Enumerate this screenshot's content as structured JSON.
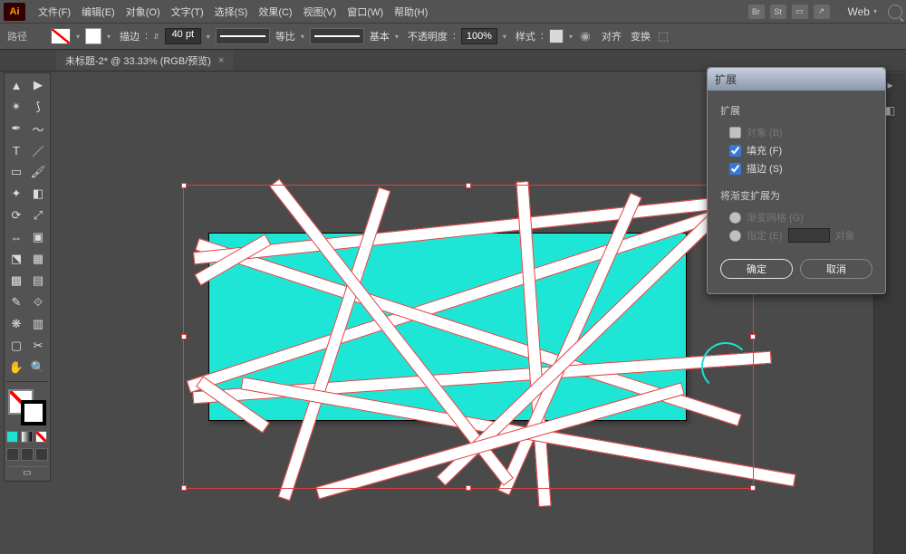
{
  "app": {
    "logo": "Ai"
  },
  "menubar": {
    "items": [
      "文件(F)",
      "编辑(E)",
      "对象(O)",
      "文字(T)",
      "选择(S)",
      "效果(C)",
      "视图(V)",
      "窗口(W)",
      "帮助(H)"
    ],
    "right_icons": [
      "Br",
      "St",
      "▭",
      "↗"
    ],
    "workspace": "Web"
  },
  "controlbar": {
    "path_label": "路径",
    "stroke_label": "描边",
    "stroke_weight": "40 pt",
    "profile_label": "等比",
    "brush_label": "基本",
    "opacity_label": "不透明度",
    "opacity_value": "100%",
    "style_label": "样式",
    "align_label": "对齐",
    "transform_label": "变换"
  },
  "tab": {
    "title": "未标题-2* @ 33.33% (RGB/预览)",
    "close": "×"
  },
  "dialog": {
    "title": "扩展",
    "section1_label": "扩展",
    "opt_object": "对象 (B)",
    "opt_fill": "填充 (F)",
    "opt_stroke": "描边 (S)",
    "section2_label": "将渐变扩展为",
    "opt_gradmesh": "渐变网格 (G)",
    "opt_spec": "指定 (E)",
    "spec_suffix": "对象",
    "ok": "确定",
    "cancel": "取消"
  },
  "canvas": {
    "artwork_color": "#1ee6d6"
  }
}
